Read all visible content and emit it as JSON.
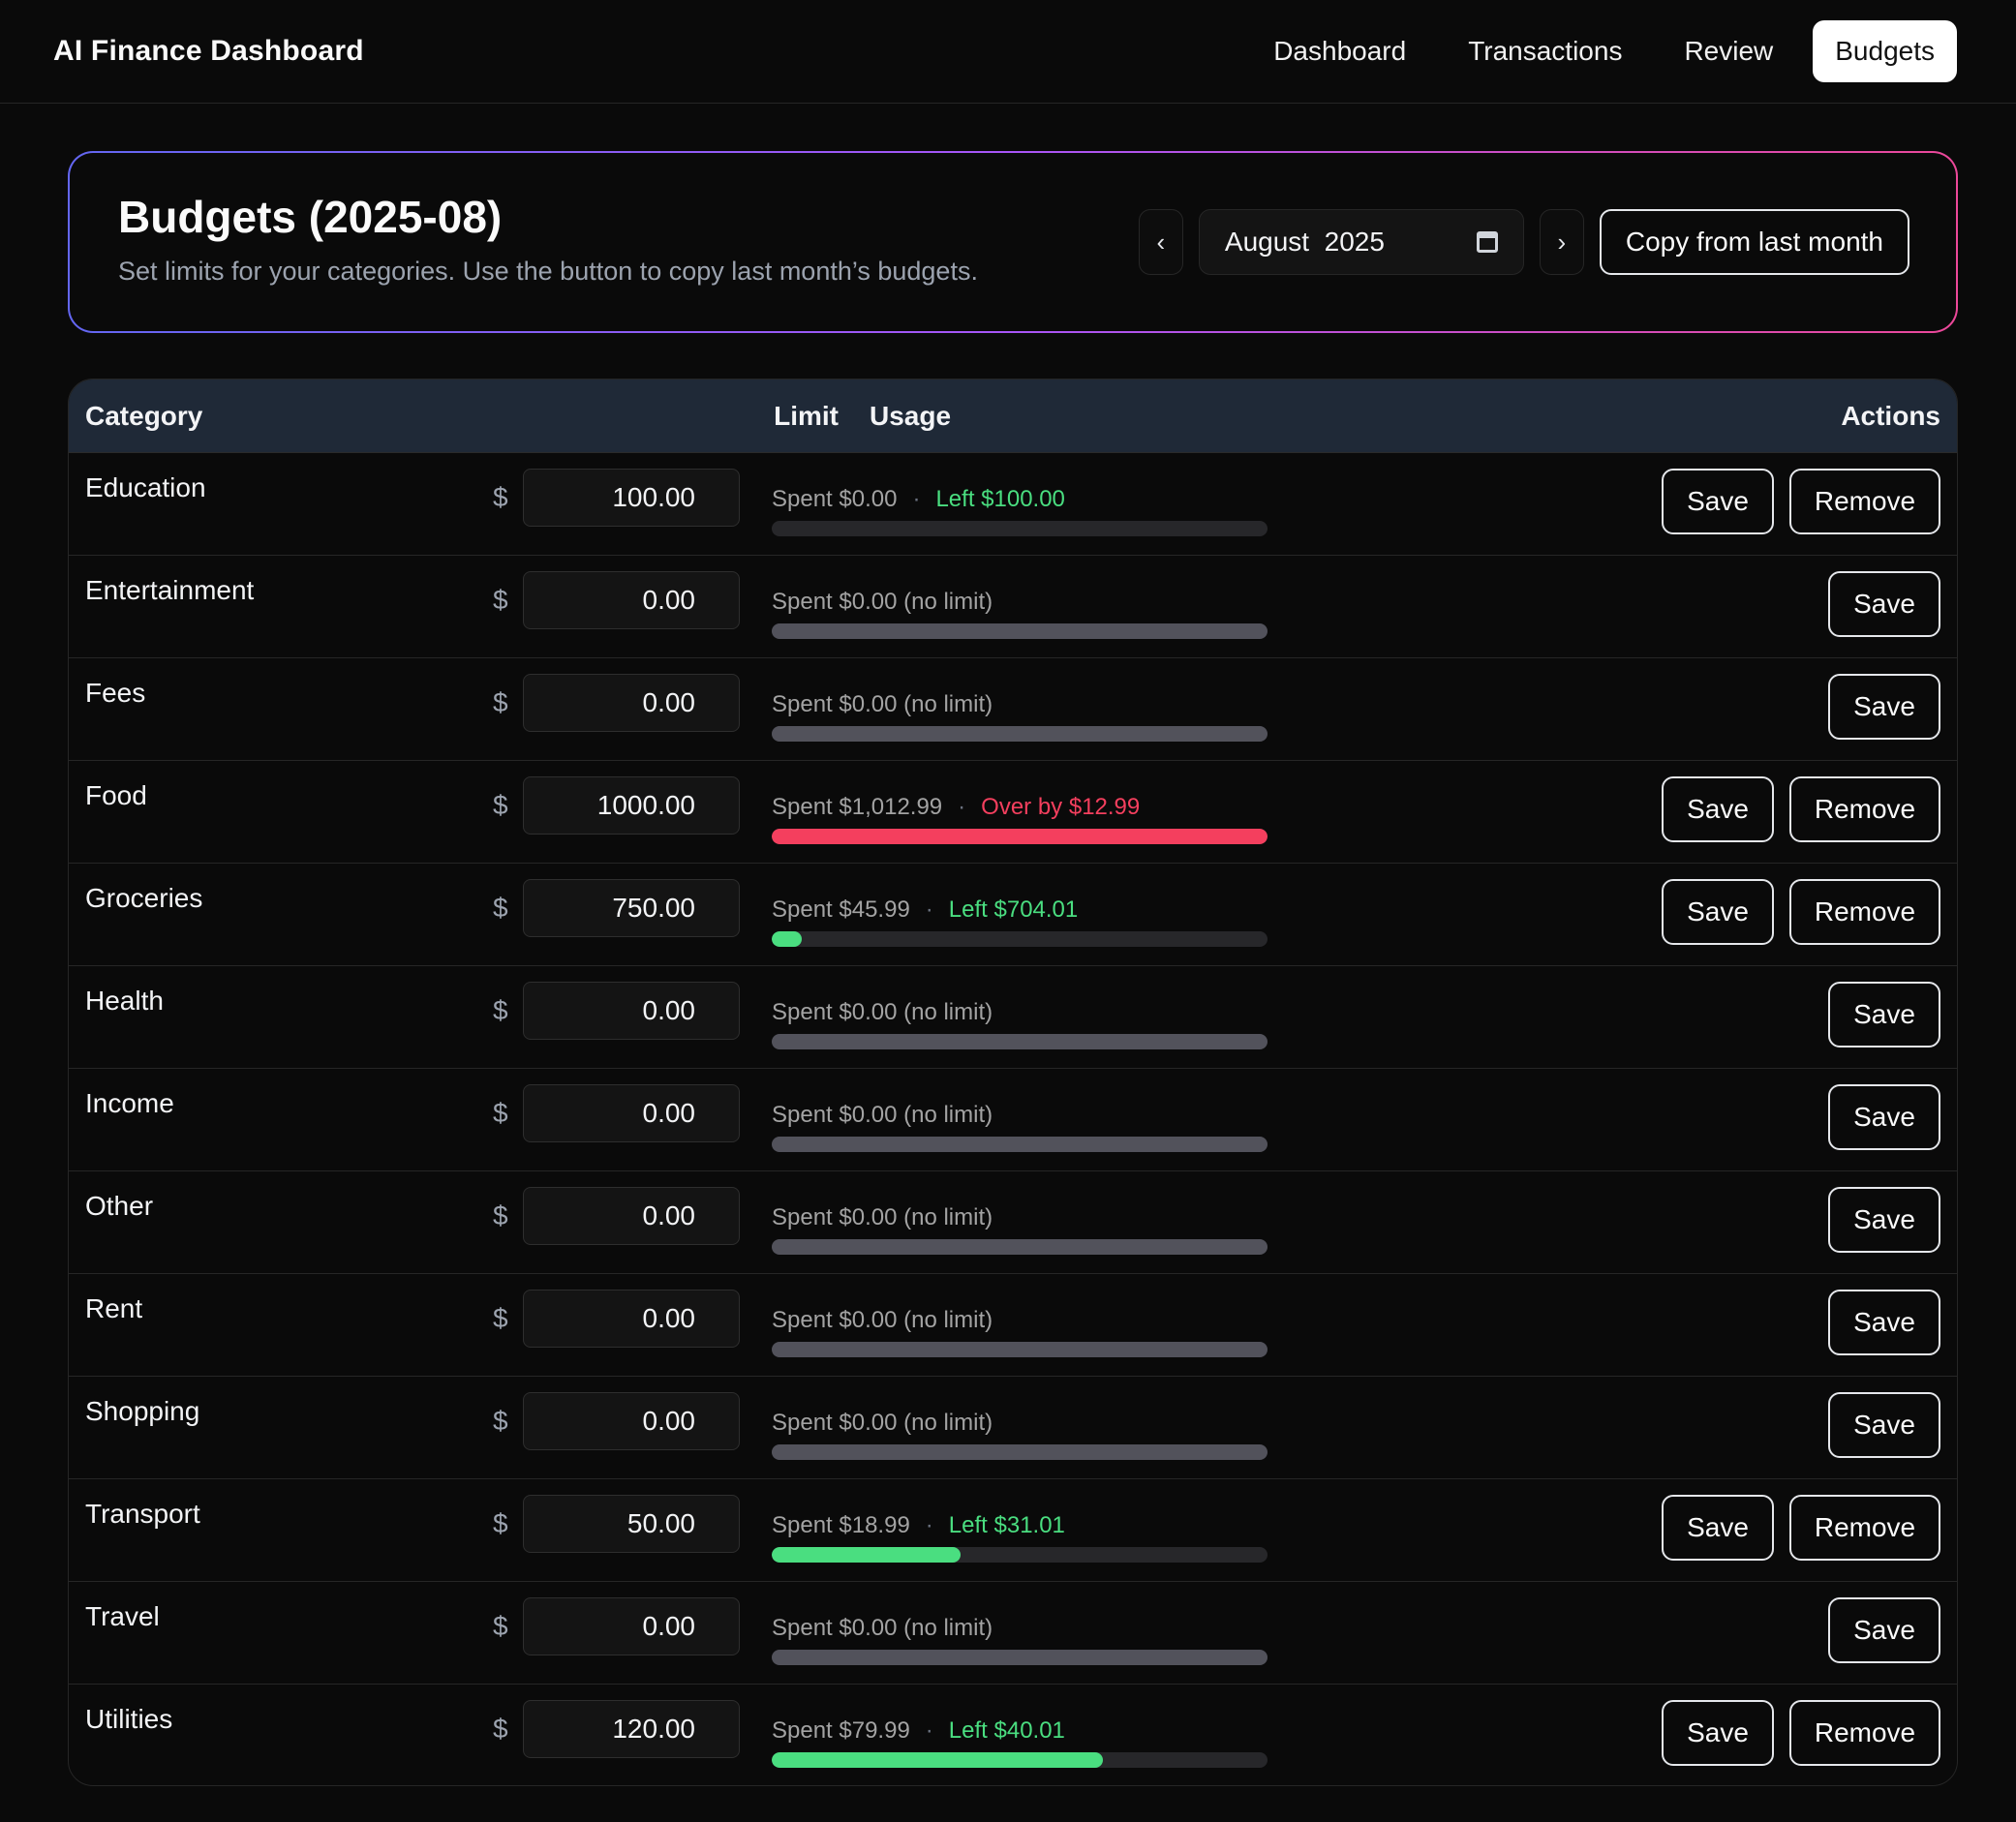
{
  "app": {
    "title": "AI Finance Dashboard"
  },
  "nav": [
    {
      "label": "Dashboard",
      "active": false
    },
    {
      "label": "Transactions",
      "active": false
    },
    {
      "label": "Review",
      "active": false
    },
    {
      "label": "Budgets",
      "active": true
    }
  ],
  "header": {
    "title": "Budgets (2025-08)",
    "subtitle": "Set limits for your categories. Use the button to copy last month’s budgets.",
    "prev_label": "‹",
    "next_label": "›",
    "month_value": "August  2025",
    "copy_label": "Copy from last month"
  },
  "table": {
    "headers": {
      "category": "Category",
      "limit": "Limit",
      "usage": "Usage",
      "actions": "Actions"
    },
    "currency_symbol": "$",
    "save_label": "Save",
    "remove_label": "Remove",
    "rows": [
      {
        "category": "Education",
        "limit": "100.00",
        "spent": "Spent $0.00",
        "status": "Left $100.00",
        "status_type": "left",
        "fill": 0,
        "has_limit": true
      },
      {
        "category": "Entertainment",
        "limit": "0.00",
        "spent": "Spent $0.00 (no limit)",
        "status": "",
        "status_type": "none",
        "fill": 0,
        "has_limit": false
      },
      {
        "category": "Fees",
        "limit": "0.00",
        "spent": "Spent $0.00 (no limit)",
        "status": "",
        "status_type": "none",
        "fill": 0,
        "has_limit": false
      },
      {
        "category": "Food",
        "limit": "1000.00",
        "spent": "Spent $1,012.99",
        "status": "Over by $12.99",
        "status_type": "over",
        "fill": 1,
        "has_limit": true
      },
      {
        "category": "Groceries",
        "limit": "750.00",
        "spent": "Spent $45.99",
        "status": "Left $704.01",
        "status_type": "left",
        "fill": 0.061,
        "has_limit": true
      },
      {
        "category": "Health",
        "limit": "0.00",
        "spent": "Spent $0.00 (no limit)",
        "status": "",
        "status_type": "none",
        "fill": 0,
        "has_limit": false
      },
      {
        "category": "Income",
        "limit": "0.00",
        "spent": "Spent $0.00 (no limit)",
        "status": "",
        "status_type": "none",
        "fill": 0,
        "has_limit": false
      },
      {
        "category": "Other",
        "limit": "0.00",
        "spent": "Spent $0.00 (no limit)",
        "status": "",
        "status_type": "none",
        "fill": 0,
        "has_limit": false
      },
      {
        "category": "Rent",
        "limit": "0.00",
        "spent": "Spent $0.00 (no limit)",
        "status": "",
        "status_type": "none",
        "fill": 0,
        "has_limit": false
      },
      {
        "category": "Shopping",
        "limit": "0.00",
        "spent": "Spent $0.00 (no limit)",
        "status": "",
        "status_type": "none",
        "fill": 0,
        "has_limit": false
      },
      {
        "category": "Transport",
        "limit": "50.00",
        "spent": "Spent $18.99",
        "status": "Left $31.01",
        "status_type": "left",
        "fill": 0.38,
        "has_limit": true
      },
      {
        "category": "Travel",
        "limit": "0.00",
        "spent": "Spent $0.00 (no limit)",
        "status": "",
        "status_type": "none",
        "fill": 0,
        "has_limit": false
      },
      {
        "category": "Utilities",
        "limit": "120.00",
        "spent": "Spent $79.99",
        "status": "Left $40.01",
        "status_type": "left",
        "fill": 0.667,
        "has_limit": true
      }
    ]
  },
  "colors": {
    "accent_green": "#4ade80",
    "accent_red": "#f43f5e",
    "header_row": "#1f2937",
    "border_gradient": [
      "#6366f1",
      "#a855f7",
      "#ec4899"
    ]
  }
}
